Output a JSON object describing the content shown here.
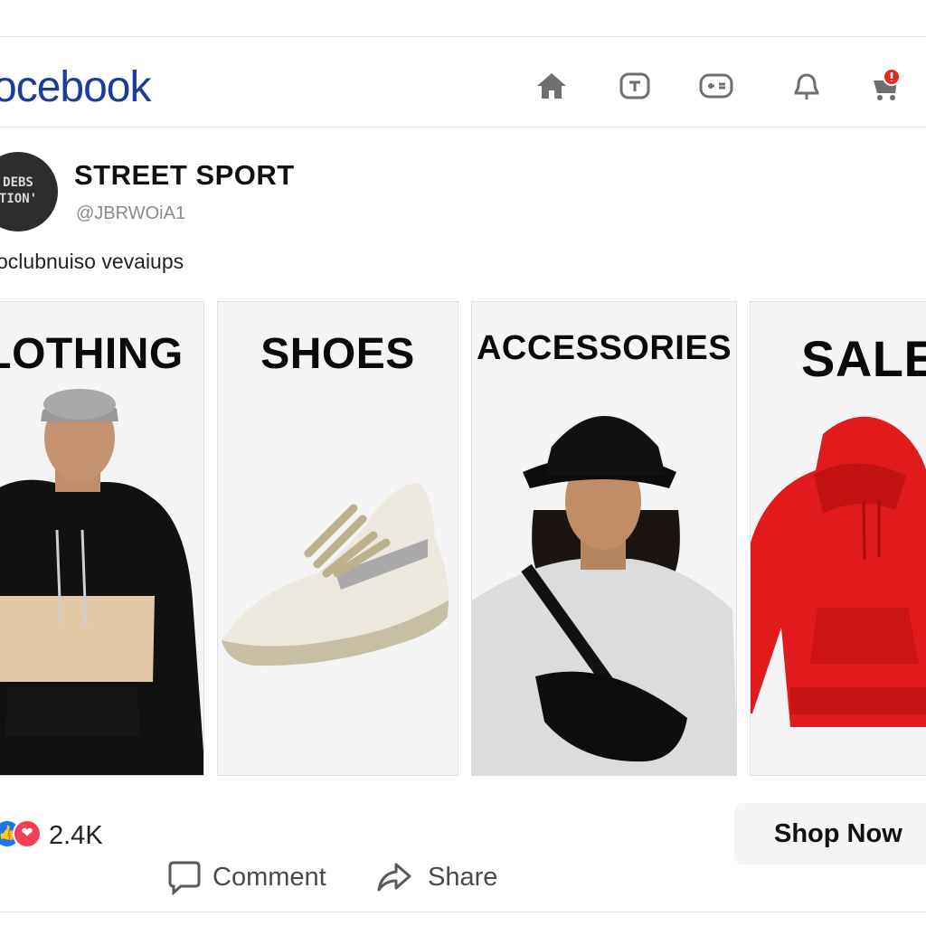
{
  "header": {
    "logo_text": "ocebook",
    "nav": [
      {
        "icon": "home-icon"
      },
      {
        "icon": "video-icon"
      },
      {
        "icon": "marketplace-icon"
      },
      {
        "icon": "bell-icon"
      },
      {
        "icon": "cart-icon",
        "badge": "!"
      }
    ]
  },
  "post": {
    "avatar_line1": "DEBS",
    "avatar_line2": "TION'",
    "page_name": "STREET SPORT",
    "handle": "@JBRWOiA1",
    "text": "oclubnuiso vevaiups"
  },
  "cards": [
    {
      "title": "LOTHING"
    },
    {
      "title": "SHOES"
    },
    {
      "title": "ACCESSORIES"
    },
    {
      "title": "SALE"
    }
  ],
  "reactions": {
    "like_icon": "thumbs-up-icon",
    "love_icon": "heart-icon",
    "count": "2.4K"
  },
  "cta": {
    "label": "Shop Now"
  },
  "actions": [
    {
      "label": "Comment",
      "icon": "comment-icon"
    },
    {
      "label": "Share",
      "icon": "share-icon"
    }
  ],
  "colors": {
    "brand": "#1c3c9c",
    "like": "#1877f2",
    "love": "#f33e58",
    "badge": "#e8261c",
    "sale_hoodie": "#e11b1b"
  }
}
